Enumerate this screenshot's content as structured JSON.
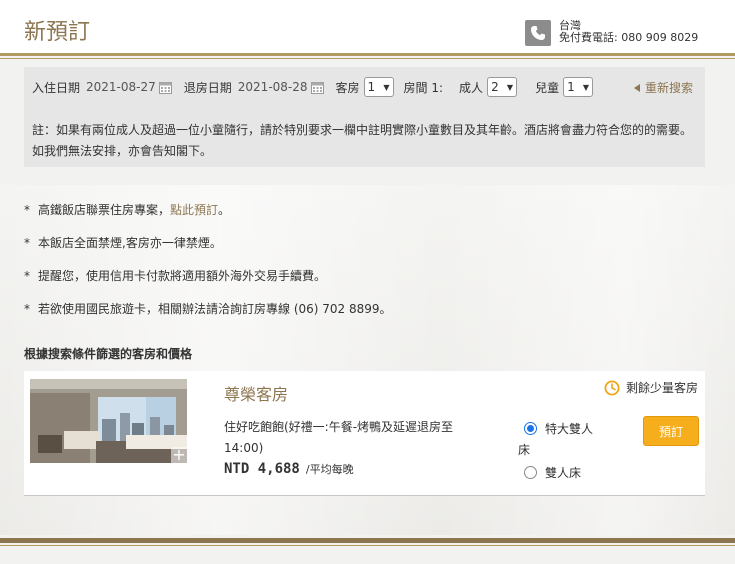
{
  "header": {
    "title": "新預訂",
    "phone_region": "台灣",
    "phone_label": "免付費電話:",
    "phone_number": "080 909 8029"
  },
  "search": {
    "checkin_label": "入住日期",
    "checkin_value": "2021-08-27",
    "checkout_label": "退房日期",
    "checkout_value": "2021-08-28",
    "rooms_label": "客房",
    "rooms_value": "1",
    "room_index_label": "房間 1:",
    "adults_label": "成人",
    "adults_value": "2",
    "children_label": "兒童",
    "children_value": "1",
    "research_label": "重新搜索",
    "note_line1": "註：如果有兩位成人及超過一位小童隨行，請於特別要求一欄中註明實際小童數目及其年齡。酒店將會盡力符合您的的需要。",
    "note_line2": "如我們無法安排，亦會告知閣下。"
  },
  "info": {
    "item1_text": "高鐵飯店聯票住房專案，",
    "item1_link": "點此預訂",
    "item1_end": "。",
    "item2": "本飯店全面禁煙,客房亦一律禁煙。",
    "item3": "提醒您，使用信用卡付款將適用額外海外交易手續費。",
    "item4": "若欲使用國民旅遊卡，相關辦法請洽詢訂房專線 (06) 702 8899。",
    "bullet": "*"
  },
  "results": {
    "section_title": "根據搜索條件篩選的客房和價格",
    "room": {
      "name": "尊榮客房",
      "availability": "剩餘少量客房",
      "plan_name": "住好吃飽飽(好禮一:午餐-烤鴨及延遲退房至14:00)",
      "price": "NTD 4,688",
      "price_unit": "/平均每晚",
      "bed_option1": "特大雙人",
      "bed_option1_cont": "床",
      "bed_option2": "雙人床",
      "book_label": "預訂"
    }
  },
  "colors": {
    "brand_gold": "#8c7650",
    "book_button": "#f7ae1c",
    "search_panel": "#e6e6e6"
  }
}
